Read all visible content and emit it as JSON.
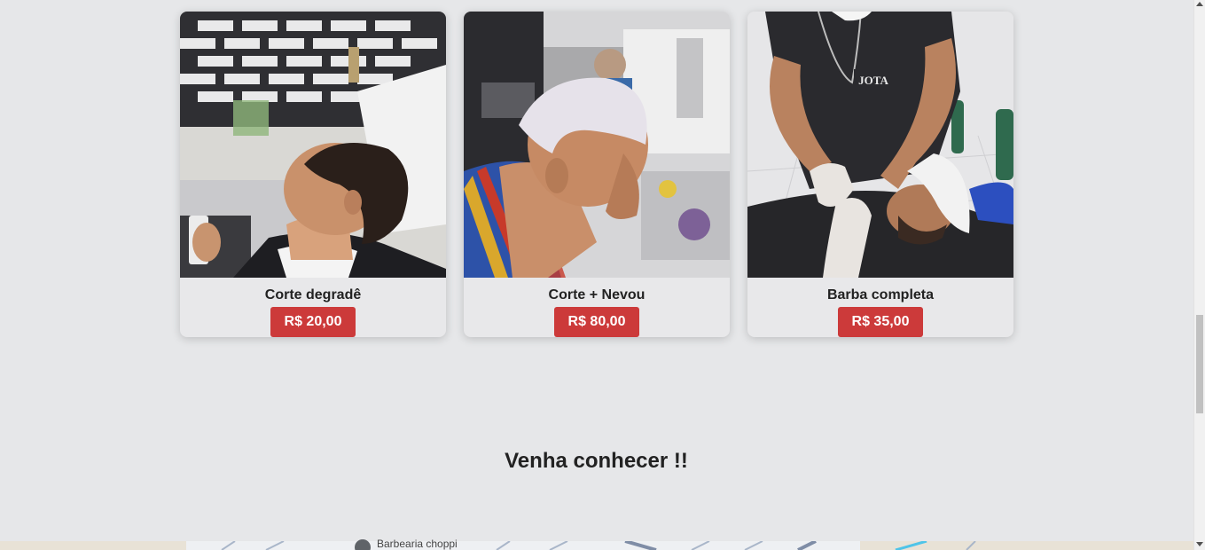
{
  "services": [
    {
      "name": "Corte degradê",
      "price": "R$ 20,00"
    },
    {
      "name": "Corte + Nevou",
      "price": "R$ 80,00"
    },
    {
      "name": "Barba completa",
      "price": "R$ 35,00"
    }
  ],
  "section": {
    "heading": "Venha conhecer !!"
  },
  "map": {
    "place_label": "Barbearia choppi"
  },
  "colors": {
    "background": "#e6e7e9",
    "price_button": "#cc3a3a",
    "card_body": "#e8e8ea"
  }
}
